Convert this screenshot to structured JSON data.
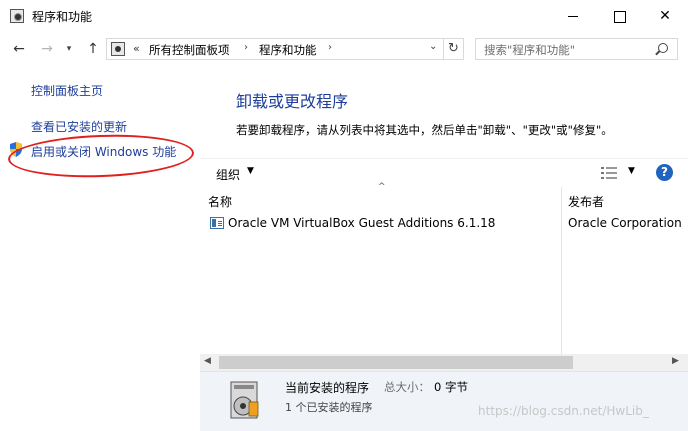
{
  "window": {
    "title": "程序和功能"
  },
  "nav": {
    "back_icon": "←",
    "forward_icon": "→",
    "recent_icon": "▾",
    "up_icon": "↑",
    "address_chevron": "«",
    "breadcrumbs": [
      "所有控制面板项",
      "程序和功能"
    ],
    "breadcrumb_separator": "›",
    "dropdown_icon": "⌄",
    "refresh_icon": "↻",
    "search_placeholder": "搜索\"程序和功能\""
  },
  "sidebar": {
    "items": [
      {
        "label": "控制面板主页"
      },
      {
        "label": "查看已安装的更新"
      },
      {
        "label": "启用或关闭 Windows 功能"
      }
    ]
  },
  "main": {
    "title": "卸载或更改程序",
    "description": "若要卸载程序，请从列表中将其选中，然后单击\"卸载\"、\"更改\"或\"修复\"。"
  },
  "toolbar": {
    "organize_label": "组织",
    "organize_arrow": "▼",
    "view_arrow": "▼",
    "help_label": "?"
  },
  "list": {
    "sort_caret": "^",
    "columns": [
      "名称",
      "发布者"
    ],
    "rows": [
      {
        "name": "Oracle VM VirtualBox Guest Additions 6.1.18",
        "publisher": "Oracle Corporation"
      }
    ]
  },
  "scrollbar": {
    "left_arrow": "◀",
    "right_arrow": "▶"
  },
  "details": {
    "title": "当前安装的程序",
    "size_label": "总大小：",
    "size_value": "0 字节",
    "count_text": "1 个已安装的程序"
  },
  "watermark": "https://blog.csdn.net/HwLib_",
  "colors": {
    "link": "#1e3e99",
    "annotation": "#e02020",
    "help": "#1f64c0"
  }
}
